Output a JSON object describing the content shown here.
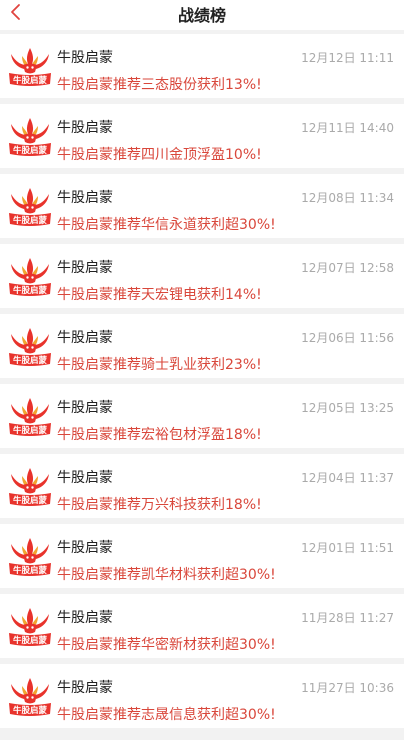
{
  "header": {
    "title": "战绩榜"
  },
  "icons": {
    "back": "chevron-left-icon",
    "avatar": "niugu-qimeng-logo"
  },
  "colors": {
    "message": "#d9473b",
    "time": "#aaaaaa",
    "back": "#e0433f",
    "logo": "#e8332c"
  },
  "items": [
    {
      "name": "牛股启蒙",
      "time": "12月12日 11:11",
      "message": "牛股启蒙推荐三态股份获利13%!"
    },
    {
      "name": "牛股启蒙",
      "time": "12月11日 14:40",
      "message": "牛股启蒙推荐四川金顶浮盈10%!"
    },
    {
      "name": "牛股启蒙",
      "time": "12月08日 11:34",
      "message": "牛股启蒙推荐华信永道获利超30%!"
    },
    {
      "name": "牛股启蒙",
      "time": "12月07日 12:58",
      "message": "牛股启蒙推荐天宏锂电获利14%!"
    },
    {
      "name": "牛股启蒙",
      "time": "12月06日 11:56",
      "message": "牛股启蒙推荐骑士乳业获利23%!"
    },
    {
      "name": "牛股启蒙",
      "time": "12月05日 13:25",
      "message": "牛股启蒙推荐宏裕包材浮盈18%!"
    },
    {
      "name": "牛股启蒙",
      "time": "12月04日 11:37",
      "message": "牛股启蒙推荐万兴科技获利18%!"
    },
    {
      "name": "牛股启蒙",
      "time": "12月01日 11:51",
      "message": "牛股启蒙推荐凯华材料获利超30%!"
    },
    {
      "name": "牛股启蒙",
      "time": "11月28日 11:27",
      "message": "牛股启蒙推荐华密新材获利超30%!"
    },
    {
      "name": "牛股启蒙",
      "time": "11月27日 10:36",
      "message": "牛股启蒙推荐志晟信息获利超30%!"
    }
  ]
}
